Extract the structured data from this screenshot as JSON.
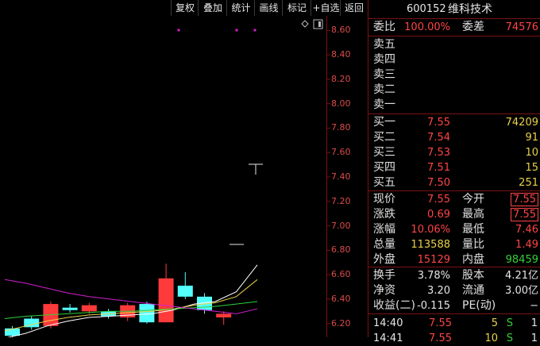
{
  "toolbar": {
    "buttons": [
      "复权",
      "叠加",
      "统计",
      "画线",
      "标记",
      "+自选",
      "返回"
    ]
  },
  "chart_data": {
    "type": "candlestick",
    "ylim": [
      6.12,
      8.68
    ],
    "y_ticks": [
      "8.60",
      "8.40",
      "8.20",
      "8.00",
      "7.80",
      "7.60",
      "7.40",
      "7.20",
      "7.00",
      "6.80",
      "6.60",
      "6.40",
      "6.20"
    ],
    "candles": [
      {
        "o": 6.16,
        "c": 6.1,
        "h": 6.18,
        "l": 6.05
      },
      {
        "o": 6.24,
        "c": 6.17,
        "h": 6.26,
        "l": 6.15
      },
      {
        "o": 6.18,
        "c": 6.36,
        "h": 6.38,
        "l": 6.16
      },
      {
        "o": 6.33,
        "c": 6.31,
        "h": 6.36,
        "l": 6.29
      },
      {
        "o": 6.3,
        "c": 6.35,
        "h": 6.37,
        "l": 6.28
      },
      {
        "o": 6.3,
        "c": 6.26,
        "h": 6.32,
        "l": 6.24
      },
      {
        "o": 6.25,
        "c": 6.35,
        "h": 6.37,
        "l": 6.22
      },
      {
        "o": 6.36,
        "c": 6.21,
        "h": 6.38,
        "l": 6.2
      },
      {
        "o": 6.21,
        "c": 6.57,
        "h": 6.69,
        "l": 6.21
      },
      {
        "o": 6.51,
        "c": 6.42,
        "h": 6.62,
        "l": 6.4
      },
      {
        "o": 6.42,
        "c": 6.31,
        "h": 6.45,
        "l": 6.28
      },
      {
        "o": 6.25,
        "c": 6.28,
        "h": 6.3,
        "l": 6.19
      }
    ],
    "ma_lines": [
      {
        "color": "#ffffff",
        "values": [
          6.08,
          6.12,
          6.18,
          6.22,
          6.25,
          6.26,
          6.27,
          6.28,
          6.31,
          6.36,
          6.38,
          6.46,
          6.68
        ]
      },
      {
        "color": "#e8d24a",
        "values": [
          6.14,
          6.18,
          6.22,
          6.25,
          6.27,
          6.28,
          6.29,
          6.3,
          6.32,
          6.35,
          6.37,
          6.42,
          6.56
        ]
      },
      {
        "color": "#2ed13a",
        "values": [
          6.24,
          6.26,
          6.27,
          6.28,
          6.29,
          6.3,
          6.3,
          6.31,
          6.32,
          6.33,
          6.34,
          6.36,
          6.38
        ]
      },
      {
        "color": "#d21ed2",
        "values": [
          6.56,
          6.53,
          6.49,
          6.45,
          6.42,
          6.4,
          6.38,
          6.36,
          6.34,
          6.32,
          6.3,
          6.28,
          6.32
        ]
      }
    ]
  },
  "panel": {
    "code": "600152",
    "name": "维科技术",
    "weibi_label": "委比",
    "weibi_value": "100.00%",
    "weicha_label": "委差",
    "weicha_value": "74576",
    "sells": [
      {
        "label": "卖五"
      },
      {
        "label": "卖四"
      },
      {
        "label": "卖三"
      },
      {
        "label": "卖二"
      },
      {
        "label": "卖一"
      }
    ],
    "buys": [
      {
        "label": "买一",
        "price": "7.55",
        "vol": "74209"
      },
      {
        "label": "买二",
        "price": "7.54",
        "vol": "91"
      },
      {
        "label": "买三",
        "price": "7.53",
        "vol": "10"
      },
      {
        "label": "买四",
        "price": "7.51",
        "vol": "15"
      },
      {
        "label": "买五",
        "price": "7.50",
        "vol": "251"
      }
    ],
    "stats": [
      {
        "l1": "现价",
        "v1": "7.55",
        "c1": "red",
        "l2": "今开",
        "v2": "7.55",
        "c2": "red",
        "boxed2": true
      },
      {
        "l1": "涨跌",
        "v1": "0.69",
        "c1": "red",
        "l2": "最高",
        "v2": "7.55",
        "c2": "red",
        "boxed2": true
      },
      {
        "l1": "涨幅",
        "v1": "10.06%",
        "c1": "red",
        "l2": "最低",
        "v2": "7.46",
        "c2": "red"
      },
      {
        "l1": "总量",
        "v1": "113588",
        "c1": "yellow",
        "l2": "量比",
        "v2": "1.49",
        "c2": "red"
      },
      {
        "l1": "外盘",
        "v1": "15129",
        "c1": "red",
        "l2": "内盘",
        "v2": "98459",
        "c2": "green"
      }
    ],
    "stats2": [
      {
        "l1": "换手",
        "v1": "3.78%",
        "c1": "white",
        "l2": "股本",
        "v2": "4.21亿",
        "c2": "white"
      },
      {
        "l1": "净资",
        "v1": "3.20",
        "c1": "white",
        "l2": "流通",
        "v2": "3.00亿",
        "c2": "white"
      },
      {
        "l1": "收益(二)",
        "v1": "-0.115",
        "c1": "white",
        "l2": "PE(动)",
        "v2": "−",
        "c2": "white"
      }
    ],
    "ticks": [
      {
        "time": "14:40",
        "price": "7.55",
        "vol": "5",
        "side": "S",
        "n": "1"
      },
      {
        "time": "14:41",
        "price": "7.55",
        "vol": "10",
        "side": "S",
        "n": "1"
      }
    ]
  }
}
